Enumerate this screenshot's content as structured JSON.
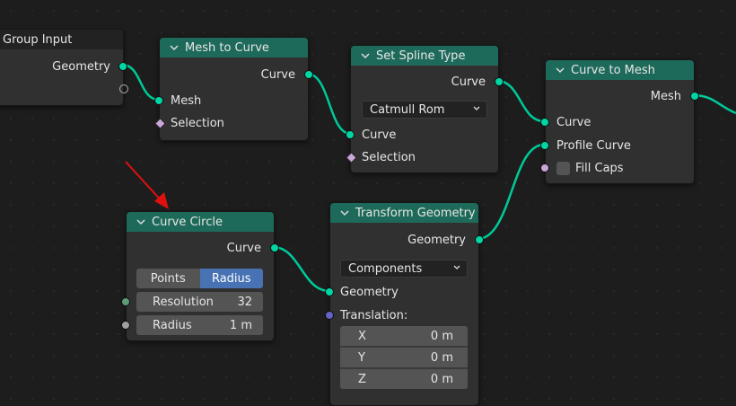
{
  "nodes": {
    "group_input": {
      "title": "Group Input",
      "out_geometry": "Geometry"
    },
    "mesh_to_curve": {
      "title": "Mesh to Curve",
      "out_curve": "Curve",
      "in_mesh": "Mesh",
      "in_selection": "Selection"
    },
    "set_spline_type": {
      "title": "Set Spline Type",
      "out_curve": "Curve",
      "type_value": "Catmull Rom",
      "in_curve": "Curve",
      "in_selection": "Selection"
    },
    "curve_to_mesh": {
      "title": "Curve to Mesh",
      "out_mesh": "Mesh",
      "in_curve": "Curve",
      "in_profile": "Profile Curve",
      "fill_caps": "Fill Caps"
    },
    "curve_circle": {
      "title": "Curve Circle",
      "out_curve": "Curve",
      "mode_points": "Points",
      "mode_radius": "Radius",
      "resolution_label": "Resolution",
      "resolution_value": "32",
      "radius_label": "Radius",
      "radius_value": "1 m"
    },
    "transform_geometry": {
      "title": "Transform Geometry",
      "out_geometry": "Geometry",
      "mode_value": "Components",
      "in_geometry": "Geometry",
      "translation_label": "Translation:",
      "x_label": "X",
      "x_value": "0 m",
      "y_label": "Y",
      "y_value": "0 m",
      "z_label": "Z",
      "z_value": "0 m"
    }
  },
  "colors": {
    "header": "#1e6a5a",
    "geometry_socket": "#00d6a3",
    "annotation_arrow": "#e01010",
    "selected_mode": "#4772b3"
  }
}
